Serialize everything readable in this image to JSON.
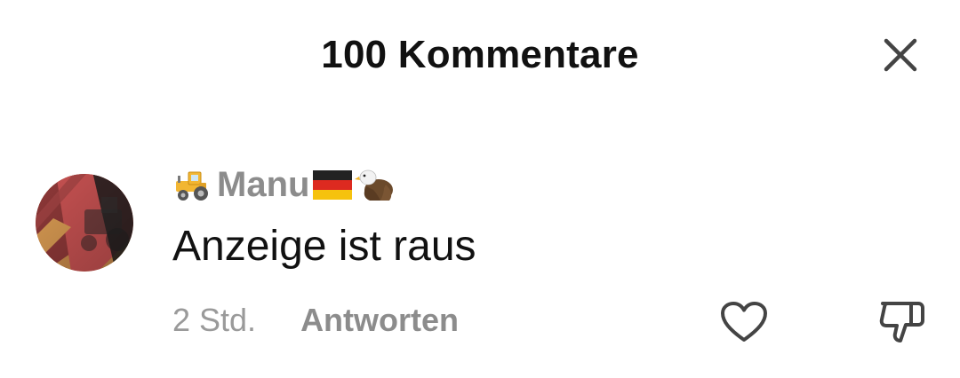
{
  "header": {
    "title": "100 Kommentare",
    "close_icon": "close-icon"
  },
  "comment": {
    "username": "Manu",
    "username_prefix_icon": "tractor-emoji",
    "username_suffix_icons": [
      "germany-flag-emoji",
      "eagle-emoji"
    ],
    "text": "Anzeige ist raus",
    "timestamp": "2 Std.",
    "reply_label": "Antworten",
    "like_icon": "heart-icon",
    "dislike_icon": "thumbs-down-icon"
  },
  "colors": {
    "title": "#111111",
    "username": "#8c8c8c",
    "timestamp": "#9a9a9a",
    "icon_stroke": "#444444"
  }
}
